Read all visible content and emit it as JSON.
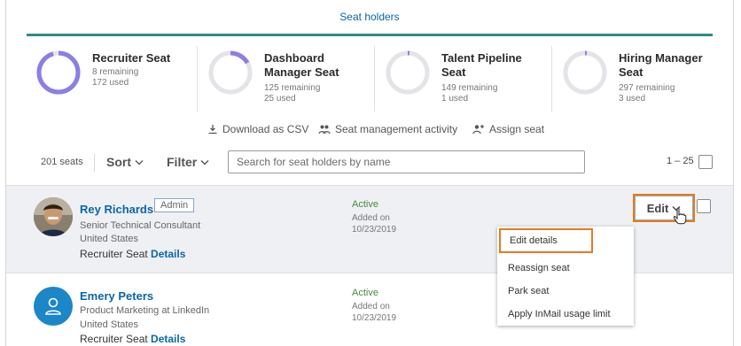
{
  "tab": {
    "label": "Seat holders"
  },
  "seats": [
    {
      "name": "Recruiter Seat",
      "remaining": "8 remaining",
      "used": "172 used",
      "fraction_used": 0.955,
      "color": "#8b7ee6"
    },
    {
      "name": "Dashboard Manager Seat",
      "remaining": "125 remaining",
      "used": "25 used",
      "fraction_used": 0.167,
      "color": "#8b7ee6"
    },
    {
      "name": "Talent Pipeline Seat",
      "remaining": "149 remaining",
      "used": "1 used",
      "fraction_used": 0.007,
      "color": "#8b7ee6"
    },
    {
      "name": "Hiring Manager Seat",
      "remaining": "297 remaining",
      "used": "3 used",
      "fraction_used": 0.01,
      "color": "#8b7ee6"
    }
  ],
  "actions": {
    "download": "Download as CSV",
    "activity": "Seat management activity",
    "assign": "Assign seat"
  },
  "toolbar": {
    "count": "201 seats",
    "sort": "Sort",
    "filter": "Filter",
    "search_placeholder": "Search for seat holders by name",
    "range": "1 – 25"
  },
  "rows": [
    {
      "name": "Rey Richards",
      "badge": "Admin",
      "title": "Senior Technical Consultant",
      "location": "United States",
      "seat": "Recruiter Seat",
      "details": "Details",
      "status": "Active",
      "added_label": "Added on",
      "added_date": "10/23/2019"
    },
    {
      "name": "Emery Peters",
      "title": "Product Marketing at LinkedIn",
      "location": "United States",
      "seat": "Recruiter Seat",
      "details": "Details",
      "status": "Active",
      "added_label": "Added on",
      "added_date": "10/23/2019"
    }
  ],
  "edit": {
    "label": "Edit"
  },
  "menu": {
    "items": [
      "Edit details",
      "Reassign seat",
      "Park seat",
      "Apply InMail usage limit"
    ]
  },
  "colors": {
    "accent": "#e37b21",
    "link": "#0a66a8",
    "tab_underline": "#2e8a8e",
    "active": "#4a8a3a"
  }
}
